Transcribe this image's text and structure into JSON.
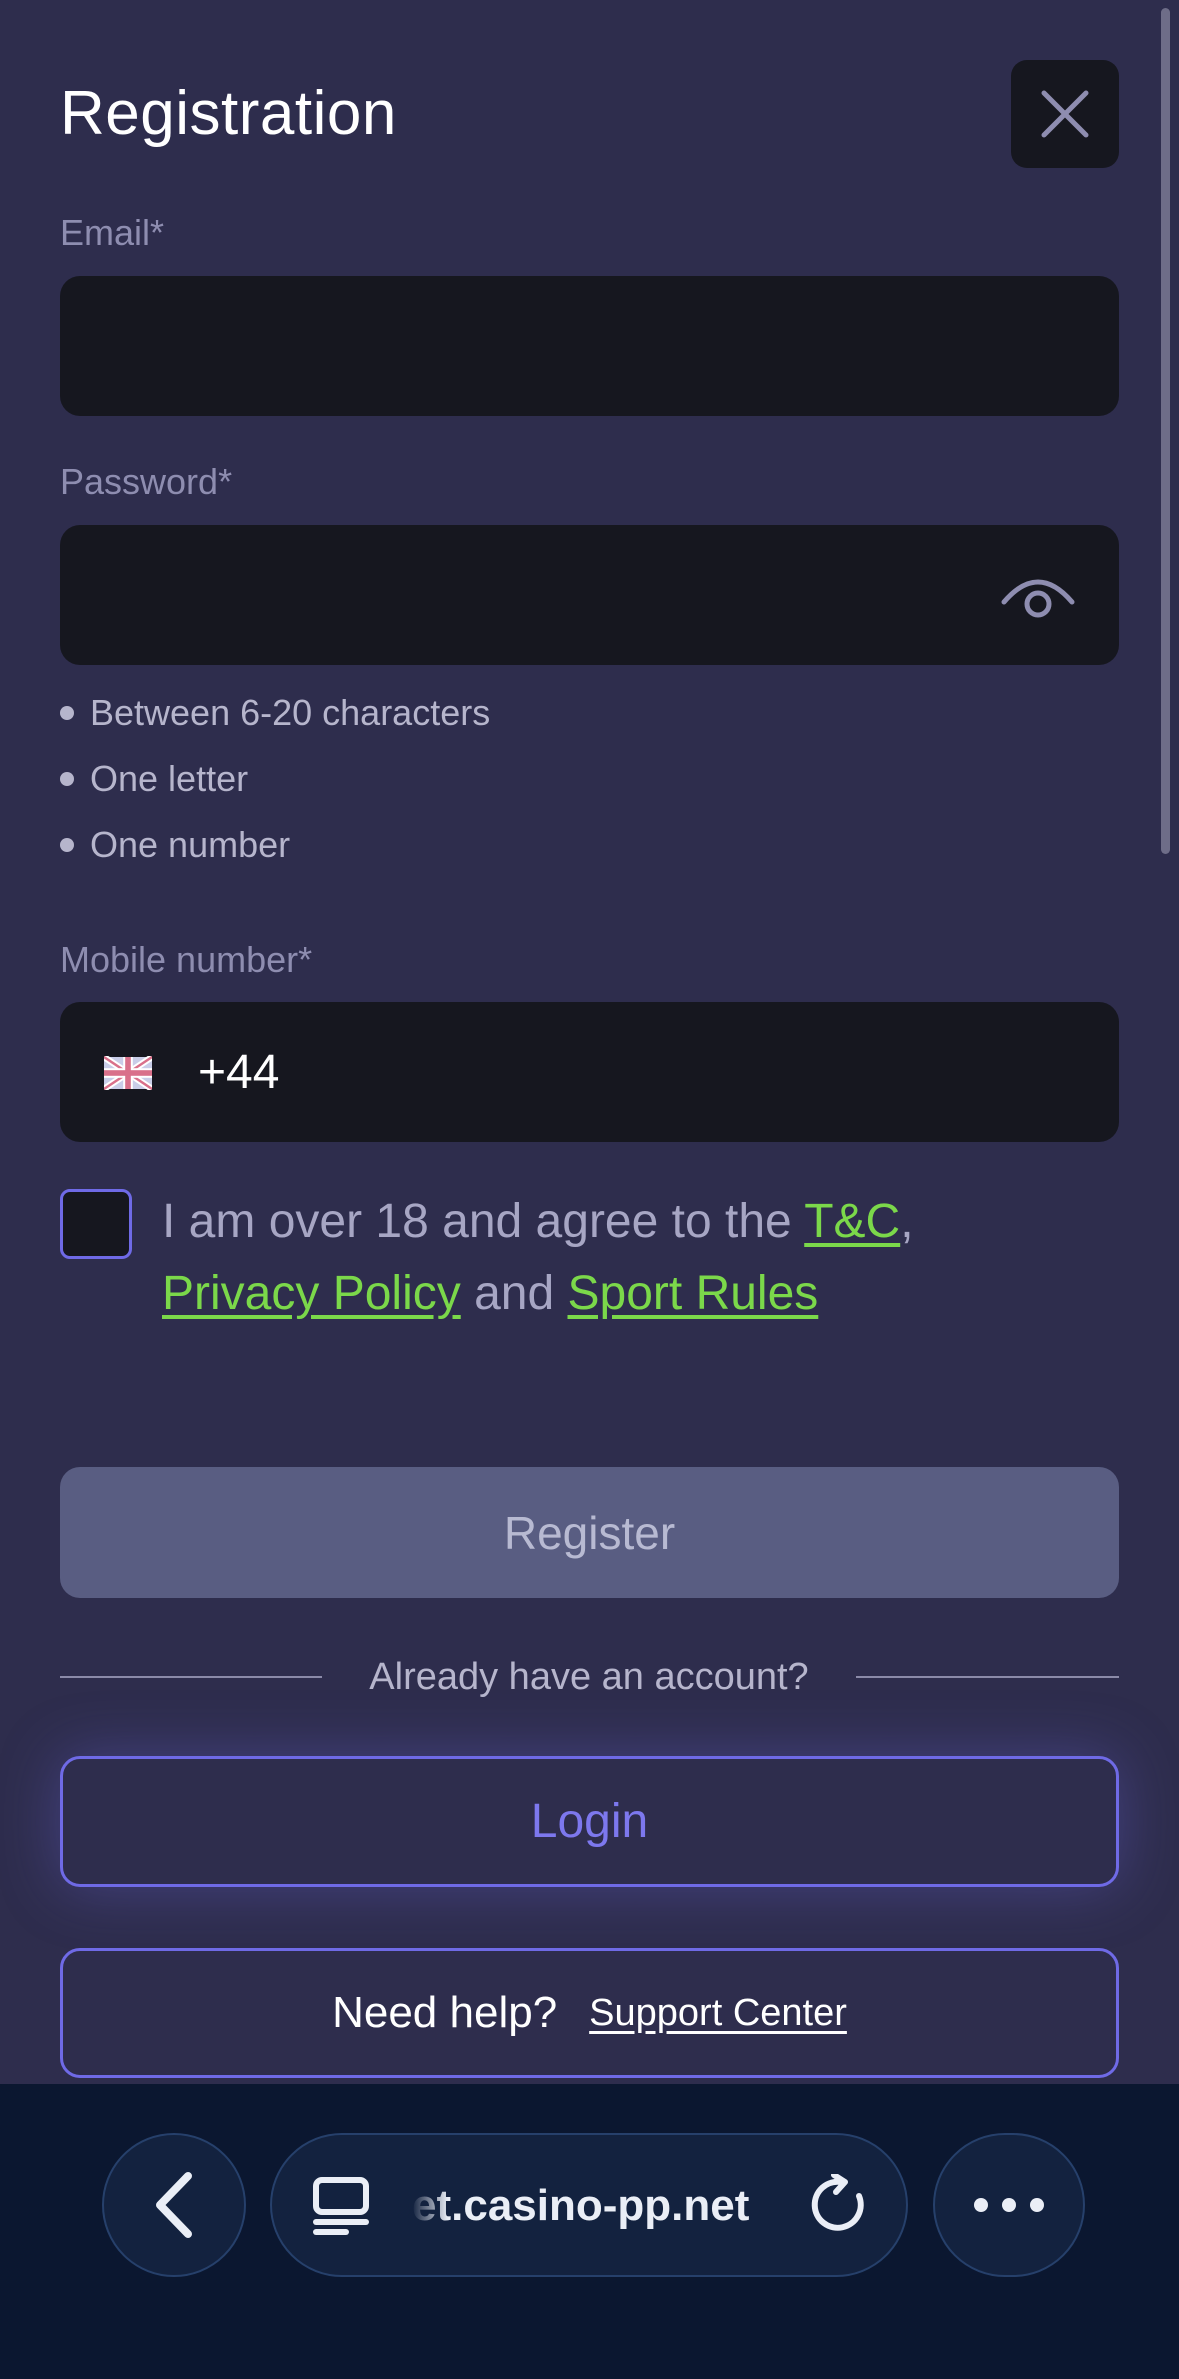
{
  "header": {
    "title": "Registration"
  },
  "form": {
    "email_label": "Email*",
    "email_value": "",
    "password_label": "Password*",
    "password_value": "",
    "password_rules": [
      "Between 6-20 characters",
      "One letter",
      "One number"
    ],
    "mobile_label": "Mobile number*",
    "mobile_country_icon": "uk-flag-icon",
    "mobile_prefix": "+44",
    "agree_text_1": "I am over 18 and agree to the ",
    "agree_link_tc": "T&C",
    "agree_comma": ",",
    "agree_link_privacy": "Privacy Policy",
    "agree_and": " and ",
    "agree_link_sport": "Sport Rules",
    "checkbox_checked": false,
    "register_label": "Register"
  },
  "account": {
    "divider_text": "Already have an account?",
    "login_label": "Login",
    "help_text": "Need help?",
    "support_link": "Support Center"
  },
  "browser": {
    "url": "et.casino-pp.net",
    "icons": [
      "back-icon",
      "tabs-icon",
      "reload-icon",
      "more-icon"
    ]
  },
  "colors": {
    "background": "#2e2d4d",
    "input_bg": "#16171f",
    "accent": "#6f6ae6",
    "link_green": "#7bd84a",
    "register_disabled": "#595d82",
    "browser_bar": "#0b1730"
  }
}
